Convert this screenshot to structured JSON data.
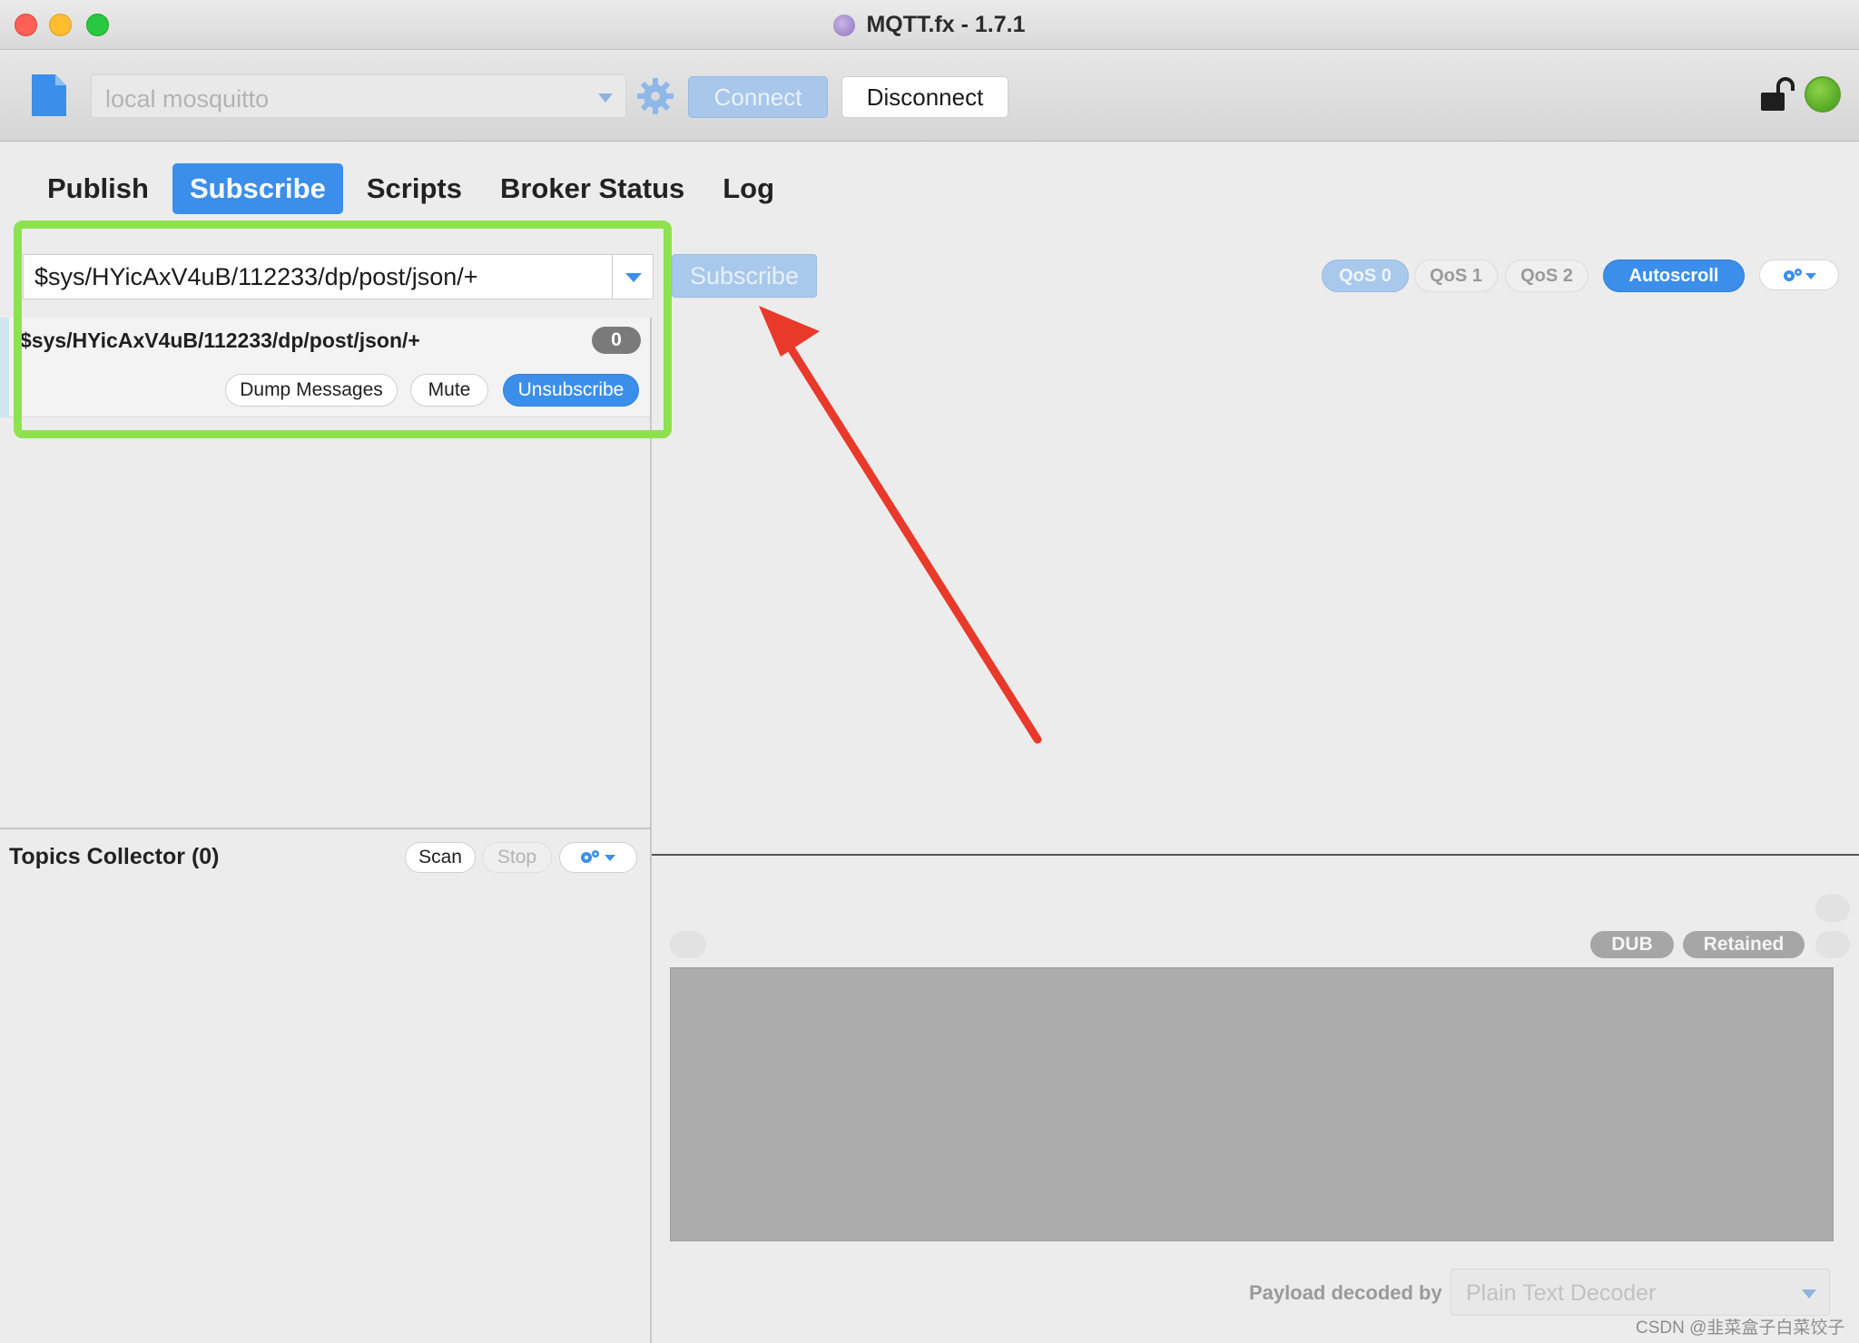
{
  "window": {
    "title": "MQTT.fx - 1.7.1"
  },
  "toolbar": {
    "profile_value": "local mosquitto",
    "connect_label": "Connect",
    "disconnect_label": "Disconnect",
    "status_color": "#4caf22"
  },
  "tabs": [
    {
      "label": "Publish",
      "active": false
    },
    {
      "label": "Subscribe",
      "active": true
    },
    {
      "label": "Scripts",
      "active": false
    },
    {
      "label": "Broker Status",
      "active": false
    },
    {
      "label": "Log",
      "active": false
    }
  ],
  "subscribe": {
    "topic_value": "$sys/HYicAxV4uB/112233/dp/post/json/+",
    "subscribe_label": "Subscribe",
    "qos": [
      "QoS 0",
      "QoS 1",
      "QoS 2"
    ],
    "selected_qos": "QoS 0",
    "autoscroll_label": "Autoscroll"
  },
  "subscriptions": [
    {
      "topic": "$sys/HYicAxV4uB/112233/dp/post/json/+",
      "count": "0",
      "dump_label": "Dump Messages",
      "mute_label": "Mute",
      "unsubscribe_label": "Unsubscribe"
    }
  ],
  "topics_collector": {
    "title": "Topics Collector (0)",
    "scan_label": "Scan",
    "stop_label": "Stop"
  },
  "message_detail": {
    "dub_label": "DUB",
    "retained_label": "Retained",
    "payload_label": "Payload decoded by",
    "decoder_value": "Plain Text Decoder"
  },
  "watermark": "CSDN @韭菜盒子白菜饺子",
  "annotation_colors": {
    "frame": "#8ee24e",
    "arrow": "#e8392a"
  }
}
